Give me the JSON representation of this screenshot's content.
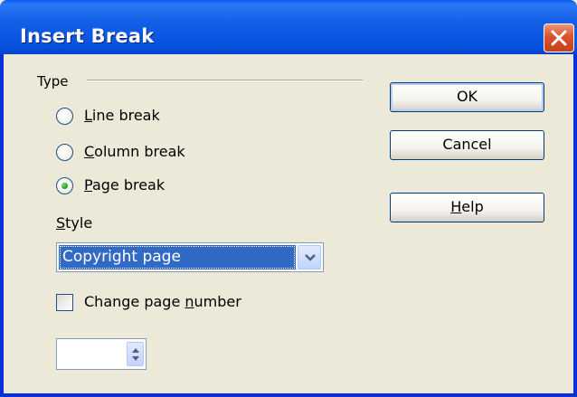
{
  "window": {
    "title": "Insert Break"
  },
  "type_group": {
    "label": "Type",
    "options": [
      {
        "first": "L",
        "rest": "ine break",
        "selected": false
      },
      {
        "first": "C",
        "rest": "olumn break",
        "selected": false
      },
      {
        "first": "P",
        "rest": "age break",
        "selected": true
      }
    ]
  },
  "style": {
    "label_first": "S",
    "label_rest": "tyle",
    "selected_value": "Copyright page"
  },
  "change_page_number": {
    "label_before": "Change page ",
    "label_access": "n",
    "label_after": "umber",
    "checked": false
  },
  "page_number": {
    "value": ""
  },
  "buttons": {
    "ok": "OK",
    "cancel": "Cancel",
    "help_first": "H",
    "help_rest": "elp"
  },
  "colors": {
    "title_bar": "#0A5BEF",
    "selection": "#316AC5",
    "close_button": "#D8532C",
    "radio_dot": "#21A121"
  },
  "icons": [
    "close-icon",
    "chevron-down-icon",
    "spin-arrows-icon"
  ]
}
